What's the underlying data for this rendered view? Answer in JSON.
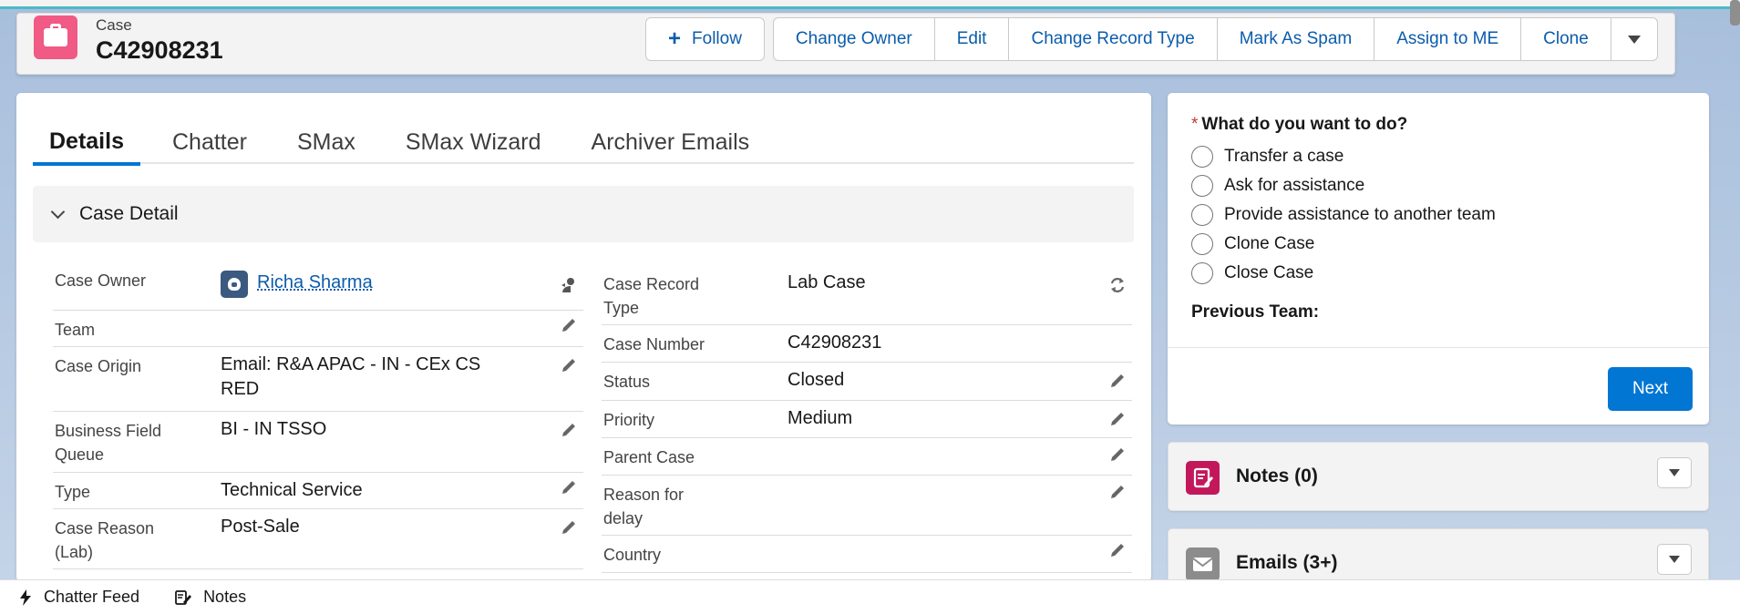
{
  "header": {
    "record_type": "Case",
    "record_name": "C42908231",
    "buttons": {
      "follow": "Follow",
      "change_owner": "Change Owner",
      "edit": "Edit",
      "change_record_type": "Change Record Type",
      "mark_as_spam": "Mark As Spam",
      "assign_to_me": "Assign to ME",
      "clone": "Clone"
    }
  },
  "tabs": [
    "Details",
    "Chatter",
    "SMax",
    "SMax Wizard",
    "Archiver Emails"
  ],
  "section": {
    "title": "Case Detail"
  },
  "left_fields": [
    {
      "label": "Case Owner",
      "value": "Richa Sharma"
    },
    {
      "label": "Team",
      "value": ""
    },
    {
      "label": "Case Origin",
      "value": "Email: R&A APAC - IN - CEx CS RED"
    },
    {
      "label": "Business Field Queue",
      "value": "BI - IN TSSO"
    },
    {
      "label": "Type",
      "value": "Technical Service"
    },
    {
      "label": "Case Reason (Lab)",
      "value": "Post-Sale"
    }
  ],
  "right_fields": [
    {
      "label": "Case Record Type",
      "value": "Lab Case"
    },
    {
      "label": "Case Number",
      "value": "C42908231"
    },
    {
      "label": "Status",
      "value": "Closed"
    },
    {
      "label": "Priority",
      "value": "Medium"
    },
    {
      "label": "Parent Case",
      "value": ""
    },
    {
      "label": "Reason for delay",
      "value": ""
    },
    {
      "label": "Country",
      "value": ""
    }
  ],
  "wizard": {
    "question": "What do you want to do?",
    "required_mark": "*",
    "options": [
      "Transfer a case",
      "Ask for assistance",
      "Provide assistance to another team",
      "Clone Case",
      "Close Case"
    ],
    "previous_team_label": "Previous Team:",
    "next_label": "Next"
  },
  "related": {
    "notes_title": "Notes (0)",
    "emails_title": "Emails (3+)",
    "notes_color": "#c2185b",
    "emails_color": "#8c8c8c"
  },
  "utility_bar": {
    "chatter_feed": "Chatter Feed",
    "notes": "Notes"
  },
  "colors": {
    "brand_blue": "#0176d3",
    "link": "#0b5cab",
    "case_icon": "#f05a84"
  }
}
